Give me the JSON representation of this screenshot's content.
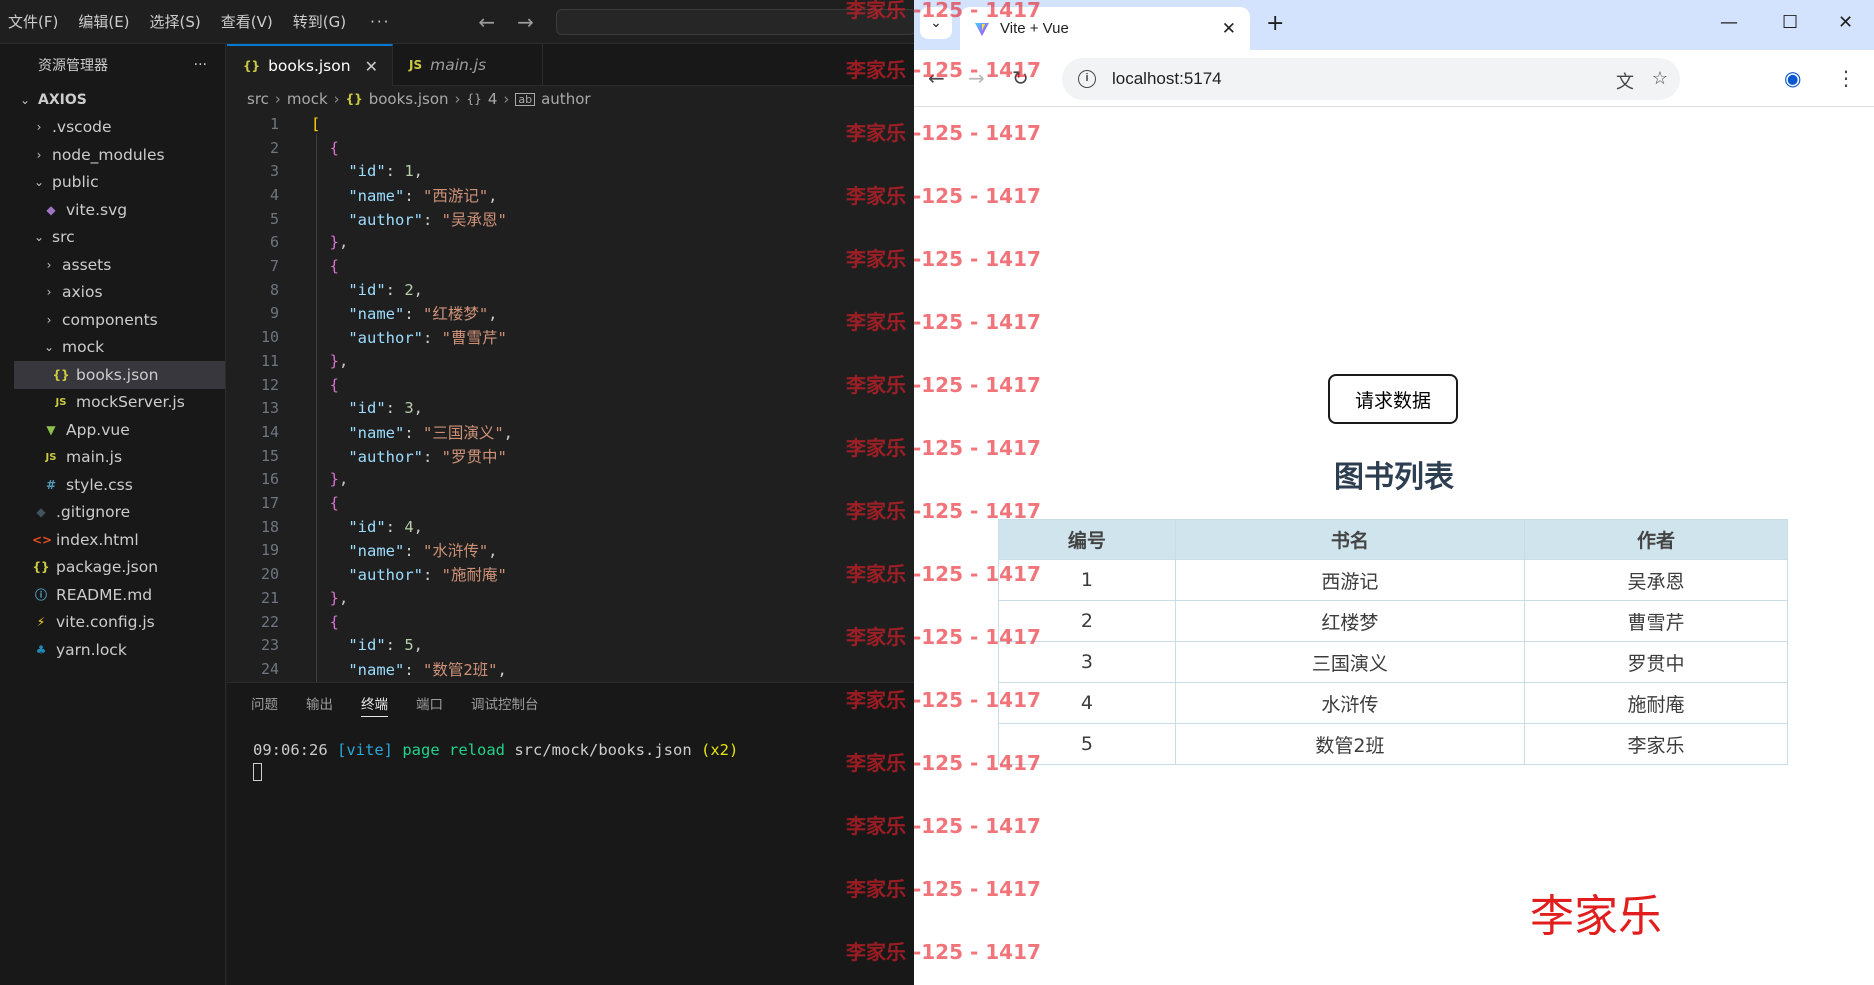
{
  "vscode": {
    "menu": [
      "文件(F)",
      "编辑(E)",
      "选择(S)",
      "查看(V)",
      "转到(G)"
    ],
    "menu_more": "···",
    "explorer_title": "资源管理器",
    "explorer_more": "···",
    "root": "AXIOS",
    "tree": [
      {
        "label": ".vscode",
        "icon": "chevron-right"
      },
      {
        "label": "node_modules",
        "icon": "chevron-right"
      },
      {
        "label": "public",
        "icon": "chevron-down"
      },
      {
        "label": "vite.svg",
        "icon": "vite-file-icon"
      },
      {
        "label": "src",
        "icon": "chevron-down"
      },
      {
        "label": "assets",
        "icon": "chevron-right"
      },
      {
        "label": "axios",
        "icon": "chevron-right"
      },
      {
        "label": "components",
        "icon": "chevron-right"
      },
      {
        "label": "mock",
        "icon": "chevron-down"
      },
      {
        "label": "books.json",
        "icon": "json-file-icon"
      },
      {
        "label": "mockServer.js",
        "icon": "js-file-icon"
      },
      {
        "label": "App.vue",
        "icon": "vue-file-icon"
      },
      {
        "label": "main.js",
        "icon": "js-file-icon"
      },
      {
        "label": "style.css",
        "icon": "css-file-icon"
      },
      {
        "label": ".gitignore",
        "icon": "git-file-icon"
      },
      {
        "label": "index.html",
        "icon": "html-file-icon"
      },
      {
        "label": "package.json",
        "icon": "json-file-icon"
      },
      {
        "label": "README.md",
        "icon": "info-file-icon"
      },
      {
        "label": "vite.config.js",
        "icon": "vite-config-icon"
      },
      {
        "label": "yarn.lock",
        "icon": "yarn-file-icon"
      }
    ],
    "tabs": [
      {
        "label": "books.json",
        "icon_text": "{}"
      },
      {
        "label": "main.js",
        "icon_text": "JS"
      }
    ],
    "breadcrumb": {
      "seg1": "src",
      "seg2": "mock",
      "seg3_icon": "{}",
      "seg3": "books.json",
      "seg4_icon": "{}",
      "seg4": "4",
      "seg5": "author"
    },
    "code": {
      "line_numbers": [
        "1",
        "2",
        "3",
        "4",
        "5",
        "6",
        "7",
        "8",
        "9",
        "10",
        "11",
        "12",
        "13",
        "14",
        "15",
        "16",
        "17",
        "18",
        "19",
        "20",
        "21",
        "22",
        "23",
        "24"
      ],
      "books": [
        {
          "id": "1",
          "name": "\"西游记\"",
          "author": "\"吴承恩\""
        },
        {
          "id": "2",
          "name": "\"红楼梦\"",
          "author": "\"曹雪芹\""
        },
        {
          "id": "3",
          "name": "\"三国演义\"",
          "author": "\"罗贯中\""
        },
        {
          "id": "4",
          "name": "\"水浒传\"",
          "author": "\"施耐庵\""
        },
        {
          "id": "5",
          "name": "\"数管2班\""
        }
      ],
      "key_id": "\"id\"",
      "key_name": "\"name\"",
      "key_author": "\"author\""
    },
    "panel_tabs": [
      "问题",
      "输出",
      "终端",
      "端口",
      "调试控制台"
    ],
    "terminal": {
      "time": "09:06:26",
      "tag": "[vite]",
      "action": "page reload",
      "path": "src/mock/books.json",
      "count": "(x2)"
    }
  },
  "browser": {
    "tab_title": "Vite + Vue",
    "url": "localhost:5174",
    "button": "请求数据",
    "heading": "图书列表",
    "table": {
      "headers": [
        "编号",
        "书名",
        "作者"
      ],
      "rows": [
        [
          "1",
          "西游记",
          "吴承恩"
        ],
        [
          "2",
          "红楼梦",
          "曹雪芹"
        ],
        [
          "3",
          "三国演义",
          "罗贯中"
        ],
        [
          "4",
          "水浒传",
          "施耐庵"
        ],
        [
          "5",
          "数管2班",
          "李家乐"
        ]
      ]
    },
    "signature": "李家乐"
  },
  "watermark": {
    "text": "李家乐 -125 - 1417",
    "color": "#e8202a"
  }
}
